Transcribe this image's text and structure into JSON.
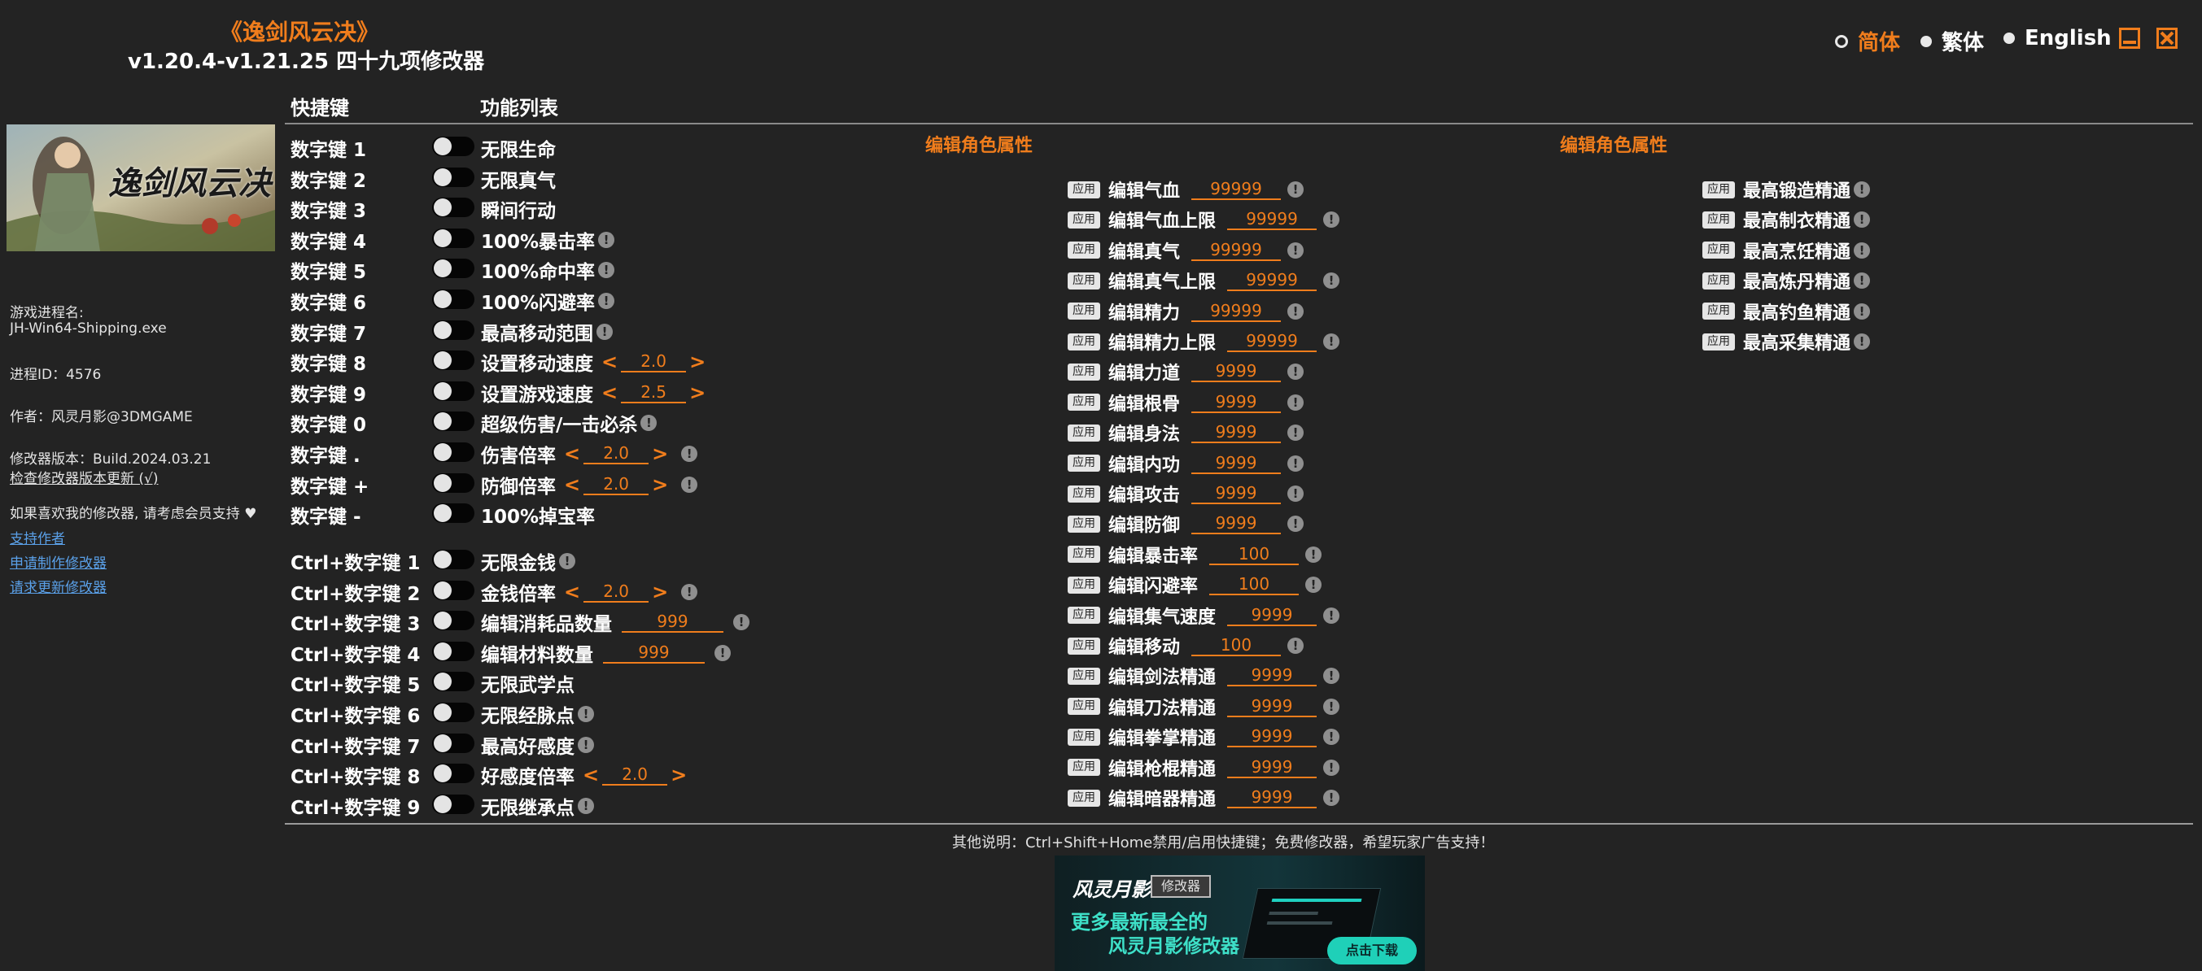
{
  "header": {
    "game_title": "《逸剑风云决》",
    "version_line": "v1.20.4-v1.21.25 四十九项修改器",
    "languages": [
      "简体",
      "繁体",
      "English"
    ],
    "selected_language": "简体"
  },
  "columns": {
    "hotkey": "快捷键",
    "features": "功能列表"
  },
  "section_titles": [
    "编辑角色属性",
    "编辑角色属性"
  ],
  "sidebar": {
    "banner_logo": "逸剑风云决",
    "process_label": "游戏进程名:",
    "process_name": "JH-Win64-Shipping.exe",
    "pid": "进程ID：4576",
    "author": "作者：风灵月影@3DMGAME",
    "build": "修改器版本：Build.2024.03.21",
    "check_update": "检查修改器版本更新 (√)",
    "support_text": "如果喜欢我的修改器, 请考虑会员支持",
    "links": [
      "支持作者",
      "申请制作修改器",
      "请求更新修改器"
    ]
  },
  "cheats": [
    {
      "hotkey": "数字键 1",
      "label": "无限生命"
    },
    {
      "hotkey": "数字键 2",
      "label": "无限真气"
    },
    {
      "hotkey": "数字键 3",
      "label": "瞬间行动"
    },
    {
      "hotkey": "数字键 4",
      "label": "100%暴击率",
      "info": true
    },
    {
      "hotkey": "数字键 5",
      "label": "100%命中率",
      "info": true
    },
    {
      "hotkey": "数字键 6",
      "label": "100%闪避率",
      "info": true
    },
    {
      "hotkey": "数字键 7",
      "label": "最高移动范围",
      "info": true
    },
    {
      "hotkey": "数字键 8",
      "label": "设置移动速度",
      "value": "2.0",
      "arrows": true
    },
    {
      "hotkey": "数字键 9",
      "label": "设置游戏速度",
      "value": "2.5",
      "arrows": true
    },
    {
      "hotkey": "数字键 0",
      "label": "超级伤害/一击必杀",
      "info": true
    },
    {
      "hotkey": "数字键 .",
      "label": "伤害倍率",
      "value": "2.0",
      "arrows": true,
      "info": true
    },
    {
      "hotkey": "数字键 +",
      "label": "防御倍率",
      "value": "2.0",
      "arrows": true,
      "info": true
    },
    {
      "hotkey": "数字键 -",
      "label": "100%掉宝率"
    },
    {
      "hotkey": "Ctrl+数字键 1",
      "label": "无限金钱",
      "info": true
    },
    {
      "hotkey": "Ctrl+数字键 2",
      "label": "金钱倍率",
      "value": "2.0",
      "arrows": true,
      "info": true
    },
    {
      "hotkey": "Ctrl+数字键 3",
      "label": "编辑消耗品数量",
      "value": "999",
      "info": true
    },
    {
      "hotkey": "Ctrl+数字键 4",
      "label": "编辑材料数量",
      "value": "999",
      "info": true
    },
    {
      "hotkey": "Ctrl+数字键 5",
      "label": "无限武学点"
    },
    {
      "hotkey": "Ctrl+数字键 6",
      "label": "无限经脉点",
      "info": true
    },
    {
      "hotkey": "Ctrl+数字键 7",
      "label": "最高好感度",
      "info": true
    },
    {
      "hotkey": "Ctrl+数字键 8",
      "label": "好感度倍率",
      "value": "2.0",
      "arrows": true
    },
    {
      "hotkey": "Ctrl+数字键 9",
      "label": "无限继承点",
      "info": true
    }
  ],
  "apply_label": "应用",
  "edits_mid": [
    {
      "label": "编辑气血",
      "value": "99999"
    },
    {
      "label": "编辑气血上限",
      "value": "99999"
    },
    {
      "label": "编辑真气",
      "value": "99999"
    },
    {
      "label": "编辑真气上限",
      "value": "99999"
    },
    {
      "label": "编辑精力",
      "value": "99999"
    },
    {
      "label": "编辑精力上限",
      "value": "99999"
    },
    {
      "label": "编辑力道",
      "value": "9999"
    },
    {
      "label": "编辑根骨",
      "value": "9999"
    },
    {
      "label": "编辑身法",
      "value": "9999"
    },
    {
      "label": "编辑内功",
      "value": "9999"
    },
    {
      "label": "编辑攻击",
      "value": "9999"
    },
    {
      "label": "编辑防御",
      "value": "9999"
    },
    {
      "label": "编辑暴击率",
      "value": "100"
    },
    {
      "label": "编辑闪避率",
      "value": "100"
    },
    {
      "label": "编辑集气速度",
      "value": "9999"
    },
    {
      "label": "编辑移动",
      "value": "100"
    },
    {
      "label": "编辑剑法精通",
      "value": "9999"
    },
    {
      "label": "编辑刀法精通",
      "value": "9999"
    },
    {
      "label": "编辑拳掌精通",
      "value": "9999"
    },
    {
      "label": "编辑枪棍精通",
      "value": "9999"
    },
    {
      "label": "编辑暗器精通",
      "value": "9999"
    }
  ],
  "edits_right": [
    {
      "label": "最高锻造精通"
    },
    {
      "label": "最高制衣精通"
    },
    {
      "label": "最高烹饪精通"
    },
    {
      "label": "最高炼丹精通"
    },
    {
      "label": "最高钓鱼精通"
    },
    {
      "label": "最高采集精通"
    }
  ],
  "footer": {
    "note": "其他说明：Ctrl+Shift+Home禁用/启用快捷键；免费修改器，希望玩家广告支持！",
    "ad": {
      "brand": "风灵月影",
      "tag": "修改器",
      "line1": "更多最新最全的",
      "line2": "风灵月影修改器",
      "button": "点击下载"
    }
  }
}
